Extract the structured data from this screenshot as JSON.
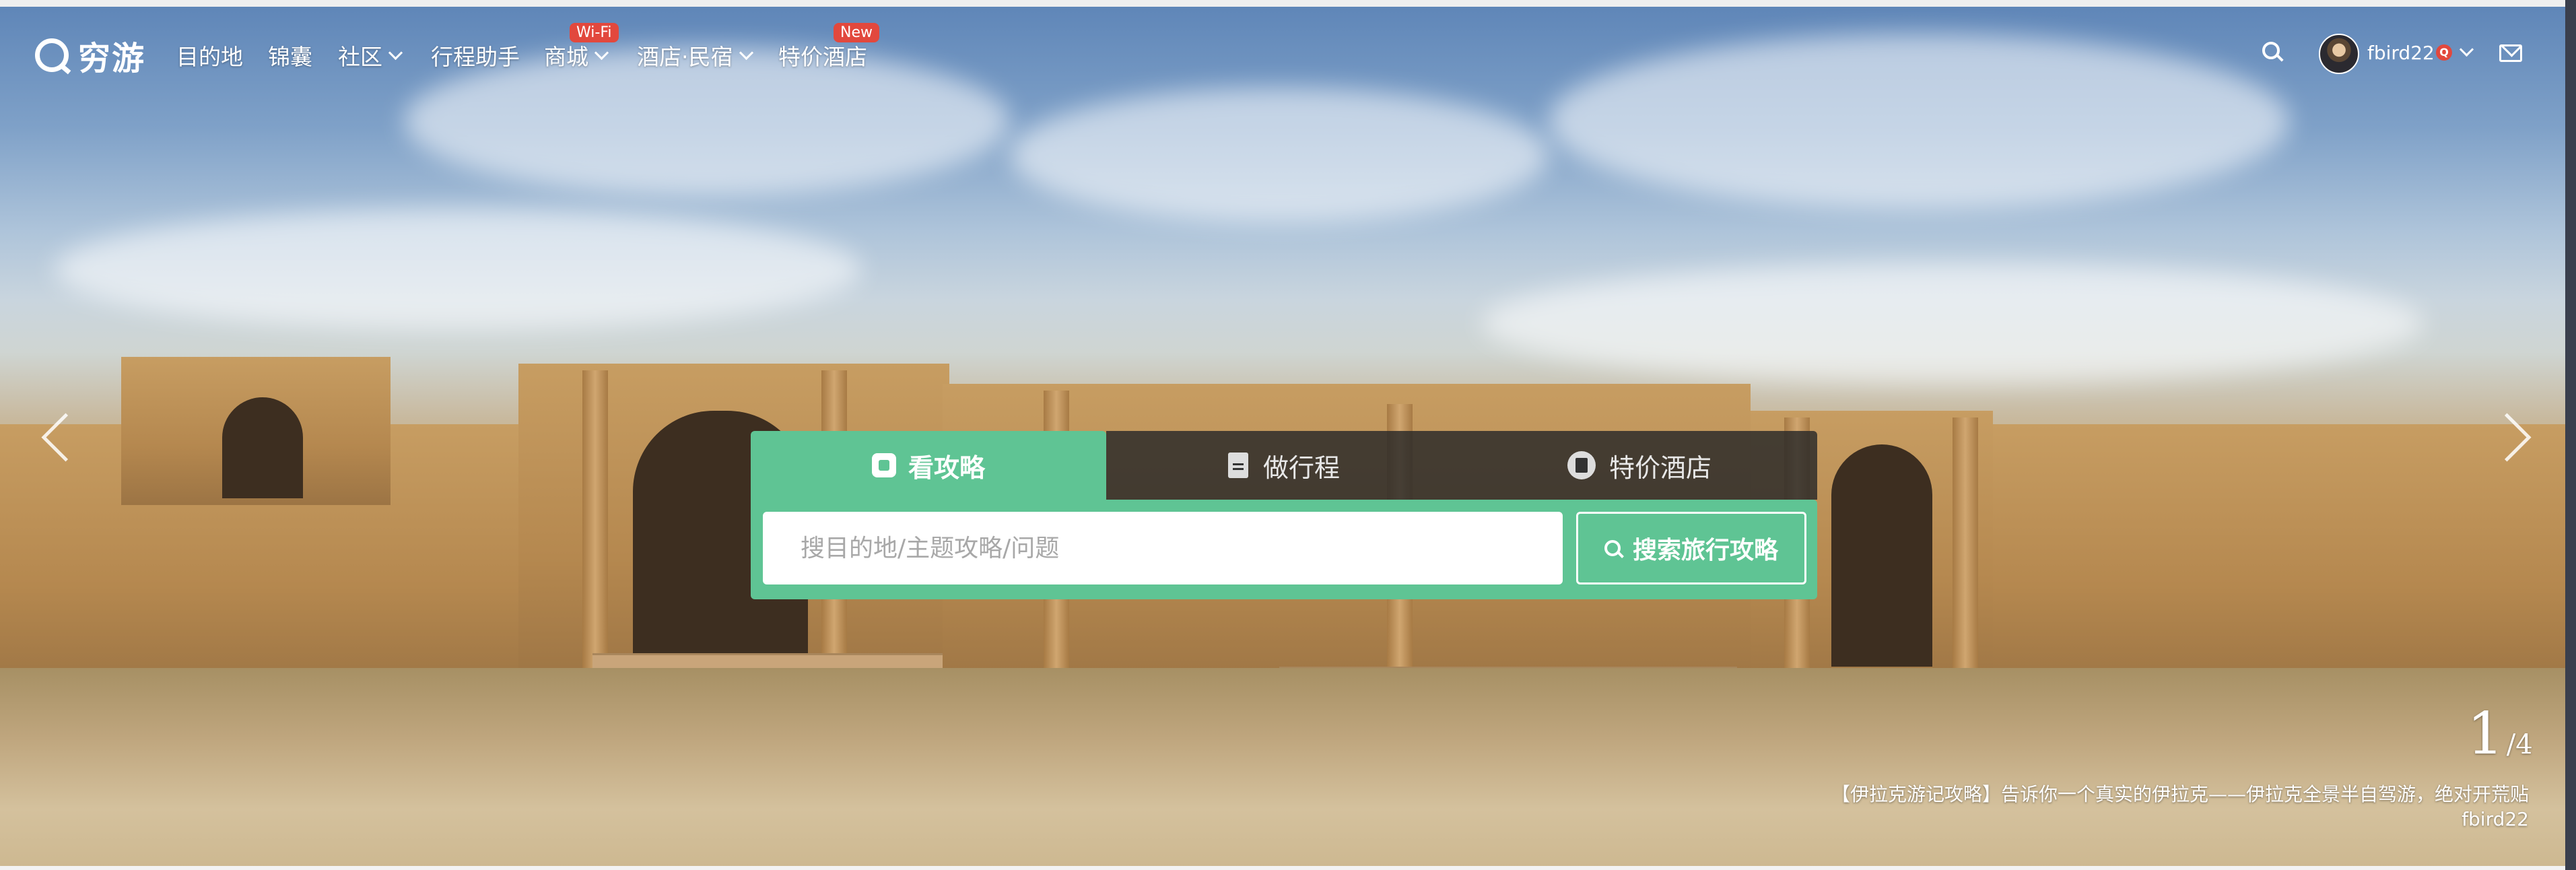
{
  "header": {
    "logo_text": "穷游",
    "nav": [
      {
        "label": "目的地",
        "has_dropdown": false
      },
      {
        "label": "锦囊",
        "has_dropdown": false
      },
      {
        "label": "社区",
        "has_dropdown": true
      },
      {
        "label": "行程助手",
        "has_dropdown": false
      },
      {
        "label": "商城",
        "has_dropdown": true,
        "badge": "Wi-Fi"
      },
      {
        "label": "酒店·民宿",
        "has_dropdown": true
      },
      {
        "label": "特价酒店",
        "has_dropdown": false,
        "badge": "New"
      }
    ],
    "user": {
      "name": "fbird22",
      "badge": "Q"
    },
    "icons": [
      "search-icon",
      "avatar",
      "chevron-down-icon",
      "mail-icon"
    ]
  },
  "search_panel": {
    "tabs": [
      {
        "label": "看攻略",
        "active": true,
        "icon": "guide-icon"
      },
      {
        "label": "做行程",
        "active": false,
        "icon": "document-icon"
      },
      {
        "label": "特价酒店",
        "active": false,
        "icon": "hotel-icon"
      }
    ],
    "input": {
      "placeholder": "搜目的地/主题攻略/问题",
      "value": ""
    },
    "button_label": "搜索旅行攻略"
  },
  "slideshow": {
    "current": "1",
    "separator": "/",
    "total": "4",
    "caption": "【伊拉克游记攻略】告诉你一个真实的伊拉克——伊拉克全景半自驾游，绝对开荒贴",
    "author": "fbird22"
  },
  "colors": {
    "accent": "#5fc494",
    "badge": "#e2483d",
    "tab_dark": "#282828"
  }
}
